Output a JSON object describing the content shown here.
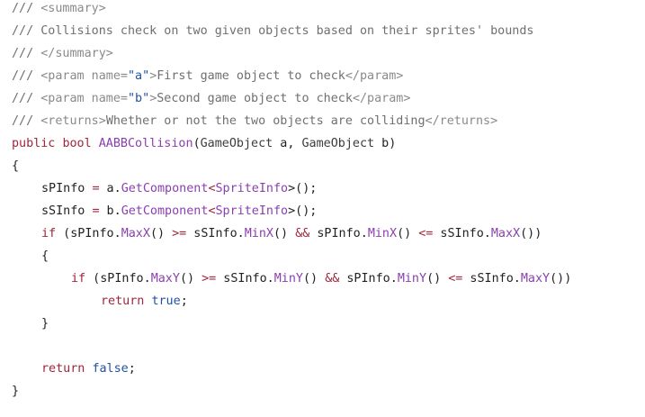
{
  "code": {
    "lines": [
      {
        "indent": 0,
        "tokens": [
          {
            "t": "/// ",
            "k": "comment"
          },
          {
            "t": "<summary>",
            "k": "doc-tag"
          }
        ]
      },
      {
        "indent": 0,
        "tokens": [
          {
            "t": "/// Collisions check on two given objects based on their sprites' bounds",
            "k": "comment"
          }
        ]
      },
      {
        "indent": 0,
        "tokens": [
          {
            "t": "/// ",
            "k": "comment"
          },
          {
            "t": "</summary>",
            "k": "doc-tag"
          }
        ]
      },
      {
        "indent": 0,
        "tokens": [
          {
            "t": "/// ",
            "k": "comment"
          },
          {
            "t": "<param name=",
            "k": "doc-tag"
          },
          {
            "t": "\"a\"",
            "k": "string"
          },
          {
            "t": ">",
            "k": "doc-tag"
          },
          {
            "t": "First game object to check",
            "k": "comment"
          },
          {
            "t": "</param>",
            "k": "doc-tag"
          }
        ]
      },
      {
        "indent": 0,
        "tokens": [
          {
            "t": "/// ",
            "k": "comment"
          },
          {
            "t": "<param name=",
            "k": "doc-tag"
          },
          {
            "t": "\"b\"",
            "k": "string"
          },
          {
            "t": ">",
            "k": "doc-tag"
          },
          {
            "t": "Second game object to check",
            "k": "comment"
          },
          {
            "t": "</param>",
            "k": "doc-tag"
          }
        ]
      },
      {
        "indent": 0,
        "tokens": [
          {
            "t": "/// ",
            "k": "comment"
          },
          {
            "t": "<returns>",
            "k": "doc-tag"
          },
          {
            "t": "Whether or not the two objects are colliding",
            "k": "comment"
          },
          {
            "t": "</returns>",
            "k": "doc-tag"
          }
        ]
      },
      {
        "indent": 0,
        "tokens": [
          {
            "t": "public",
            "k": "keyword"
          },
          {
            "t": " ",
            "k": "plain"
          },
          {
            "t": "bool",
            "k": "keyword"
          },
          {
            "t": " ",
            "k": "plain"
          },
          {
            "t": "AABBCollision",
            "k": "method"
          },
          {
            "t": "(",
            "k": "plain"
          },
          {
            "t": "GameObject",
            "k": "type"
          },
          {
            "t": " a, ",
            "k": "plain"
          },
          {
            "t": "GameObject",
            "k": "type"
          },
          {
            "t": " b)",
            "k": "plain"
          }
        ]
      },
      {
        "indent": 0,
        "tokens": [
          {
            "t": "{",
            "k": "plain"
          }
        ]
      },
      {
        "indent": 1,
        "tokens": [
          {
            "t": "sPInfo ",
            "k": "plain"
          },
          {
            "t": "=",
            "k": "operator"
          },
          {
            "t": " a.",
            "k": "plain"
          },
          {
            "t": "GetComponent",
            "k": "method"
          },
          {
            "t": "<",
            "k": "operator"
          },
          {
            "t": "SpriteInfo",
            "k": "method"
          },
          {
            "t": ">();",
            "k": "plain"
          }
        ]
      },
      {
        "indent": 1,
        "tokens": [
          {
            "t": "sSInfo ",
            "k": "plain"
          },
          {
            "t": "=",
            "k": "operator"
          },
          {
            "t": " b.",
            "k": "plain"
          },
          {
            "t": "GetComponent",
            "k": "method"
          },
          {
            "t": "<",
            "k": "operator"
          },
          {
            "t": "SpriteInfo",
            "k": "method"
          },
          {
            "t": ">();",
            "k": "plain"
          }
        ]
      },
      {
        "indent": 1,
        "tokens": [
          {
            "t": "if",
            "k": "keyword"
          },
          {
            "t": " (sPInfo.",
            "k": "plain"
          },
          {
            "t": "MaxX",
            "k": "method"
          },
          {
            "t": "() ",
            "k": "plain"
          },
          {
            "t": ">=",
            "k": "operator"
          },
          {
            "t": " sSInfo.",
            "k": "plain"
          },
          {
            "t": "MinX",
            "k": "method"
          },
          {
            "t": "() ",
            "k": "plain"
          },
          {
            "t": "&&",
            "k": "operator"
          },
          {
            "t": " sPInfo.",
            "k": "plain"
          },
          {
            "t": "MinX",
            "k": "method"
          },
          {
            "t": "() ",
            "k": "plain"
          },
          {
            "t": "<=",
            "k": "operator"
          },
          {
            "t": " sSInfo.",
            "k": "plain"
          },
          {
            "t": "MaxX",
            "k": "method"
          },
          {
            "t": "())",
            "k": "plain"
          }
        ]
      },
      {
        "indent": 1,
        "tokens": [
          {
            "t": "{",
            "k": "plain"
          }
        ]
      },
      {
        "indent": 2,
        "tokens": [
          {
            "t": "if",
            "k": "keyword"
          },
          {
            "t": " (sPInfo.",
            "k": "plain"
          },
          {
            "t": "MaxY",
            "k": "method"
          },
          {
            "t": "() ",
            "k": "plain"
          },
          {
            "t": ">=",
            "k": "operator"
          },
          {
            "t": " sSInfo.",
            "k": "plain"
          },
          {
            "t": "MinY",
            "k": "method"
          },
          {
            "t": "() ",
            "k": "plain"
          },
          {
            "t": "&&",
            "k": "operator"
          },
          {
            "t": " sPInfo.",
            "k": "plain"
          },
          {
            "t": "MinY",
            "k": "method"
          },
          {
            "t": "() ",
            "k": "plain"
          },
          {
            "t": "<=",
            "k": "operator"
          },
          {
            "t": " sSInfo.",
            "k": "plain"
          },
          {
            "t": "MaxY",
            "k": "method"
          },
          {
            "t": "())",
            "k": "plain"
          }
        ]
      },
      {
        "indent": 3,
        "tokens": [
          {
            "t": "return",
            "k": "keyword"
          },
          {
            "t": " ",
            "k": "plain"
          },
          {
            "t": "true",
            "k": "literal"
          },
          {
            "t": ";",
            "k": "plain"
          }
        ]
      },
      {
        "indent": 1,
        "tokens": [
          {
            "t": "}",
            "k": "plain"
          }
        ]
      },
      {
        "indent": 0,
        "tokens": []
      },
      {
        "indent": 1,
        "tokens": [
          {
            "t": "return",
            "k": "keyword"
          },
          {
            "t": " ",
            "k": "plain"
          },
          {
            "t": "false",
            "k": "literal"
          },
          {
            "t": ";",
            "k": "plain"
          }
        ]
      },
      {
        "indent": 0,
        "tokens": [
          {
            "t": "}",
            "k": "plain"
          }
        ]
      }
    ]
  }
}
